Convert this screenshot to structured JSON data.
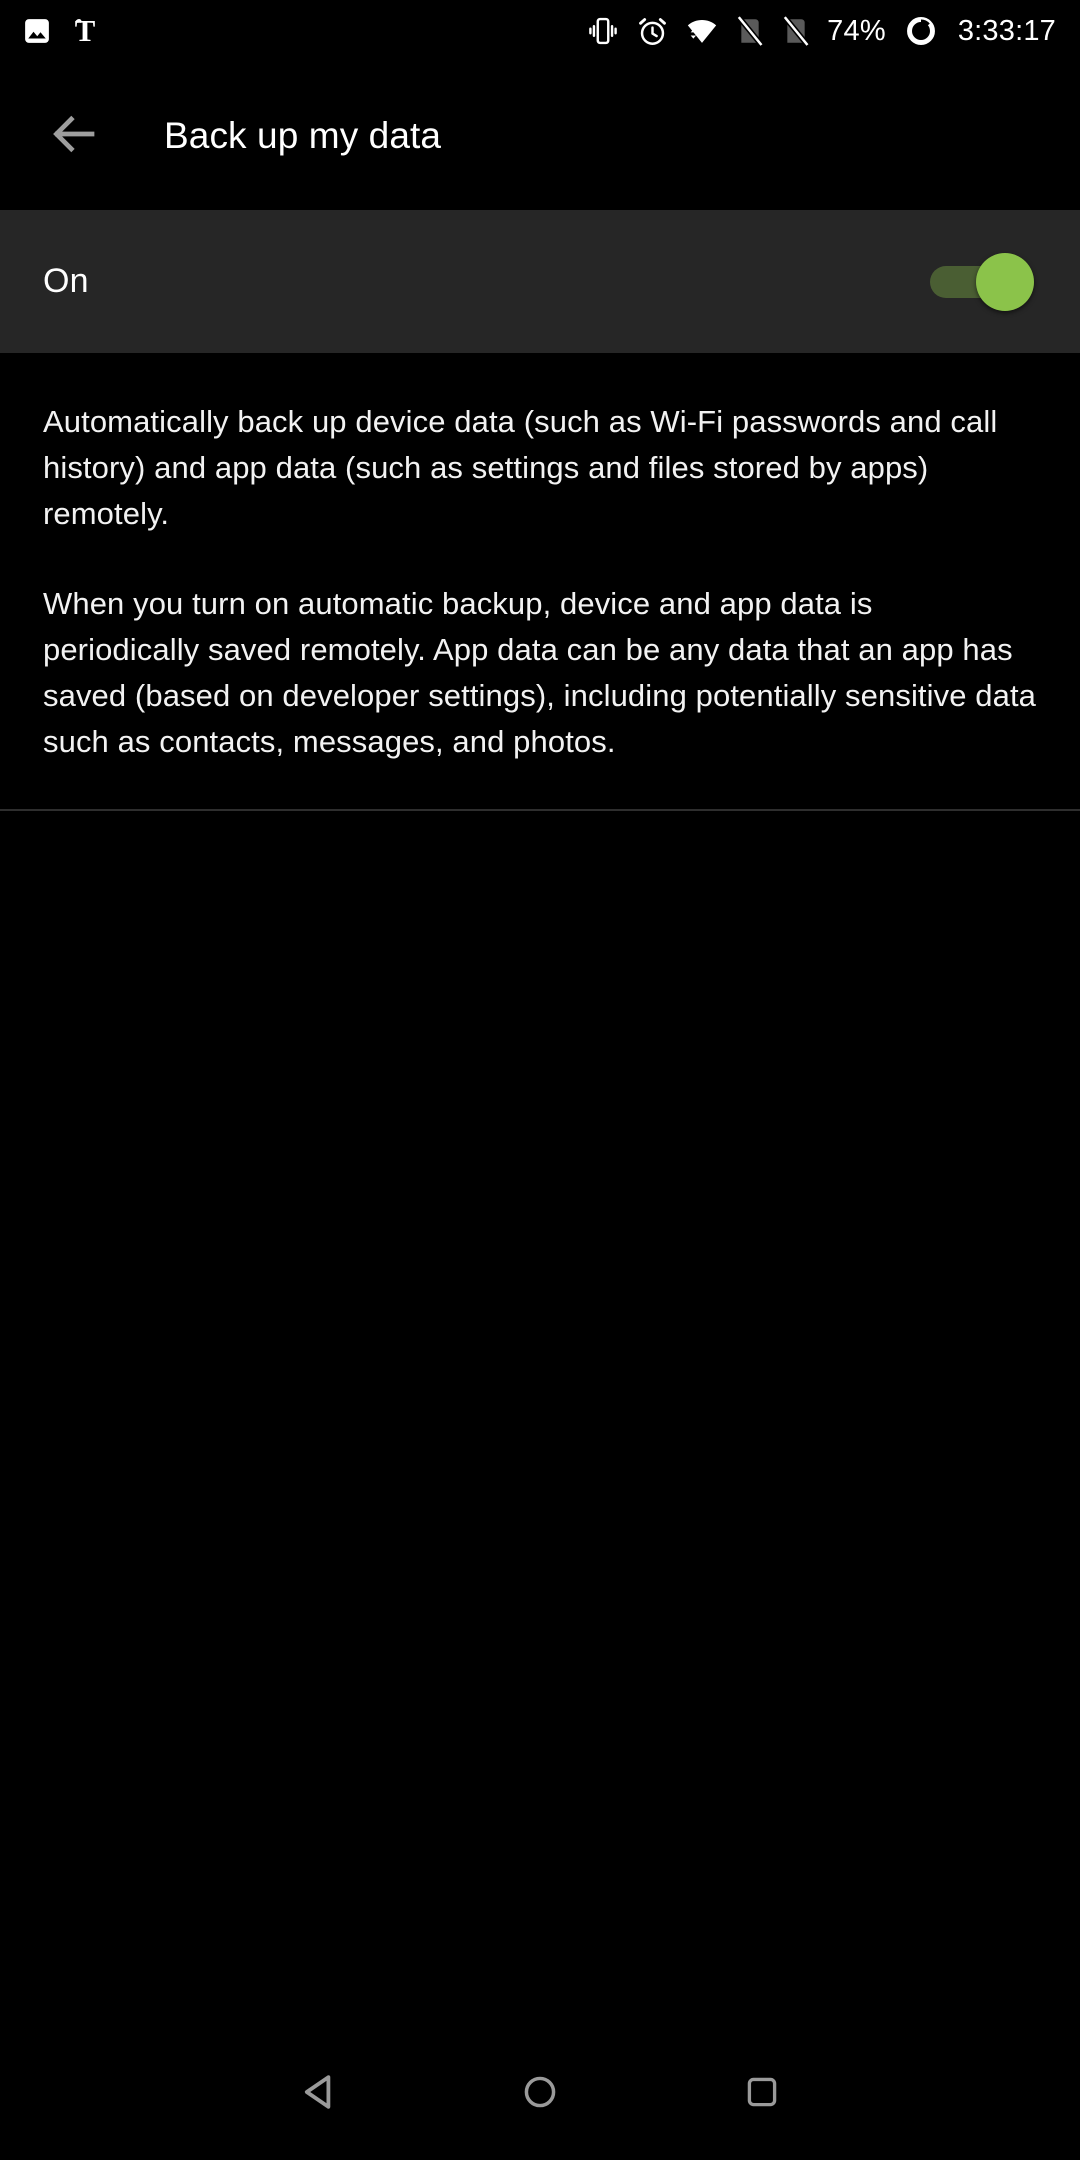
{
  "status_bar": {
    "notifications": [
      {
        "name": "photos-icon",
        "label": "Photos"
      },
      {
        "name": "nytimes-icon",
        "label": "The New York Times"
      }
    ],
    "system_icons": [
      {
        "name": "vibrate-icon",
        "label": "Vibrate"
      },
      {
        "name": "alarm-icon",
        "label": "Alarm set"
      },
      {
        "name": "wifi-icon",
        "label": "Wi-Fi connected"
      },
      {
        "name": "sim1-no-signal-icon",
        "label": "SIM 1 no signal"
      },
      {
        "name": "sim2-no-signal-icon",
        "label": "SIM 2 no signal"
      }
    ],
    "battery_percent": "74%",
    "battery_icon": "battery-circle-icon",
    "clock": "3:33:17"
  },
  "app_bar": {
    "back_icon": "arrow-left-icon",
    "title": "Back up my data"
  },
  "toggle_row": {
    "label": "On",
    "state": "on",
    "accent_color": "#8BC34A"
  },
  "description": {
    "paragraph_1": "Automatically back up device data (such as Wi-Fi passwords and call history) and app data (such as settings and files stored by apps) remotely.",
    "paragraph_2": "When you turn on automatic backup, device and app data is periodically saved remotely. App data can be any data that an app has saved (based on developer settings), including potentially sensitive data such as contacts, messages, and photos."
  },
  "nav_bar": {
    "back": "back-triangle-icon",
    "home": "home-circle-icon",
    "recents": "recents-square-icon"
  },
  "colors": {
    "background": "#000000",
    "row_background": "#262626",
    "divider": "#2e2e2e",
    "icon_grey": "#9a9a9a",
    "accent_green": "#8BC34A"
  }
}
